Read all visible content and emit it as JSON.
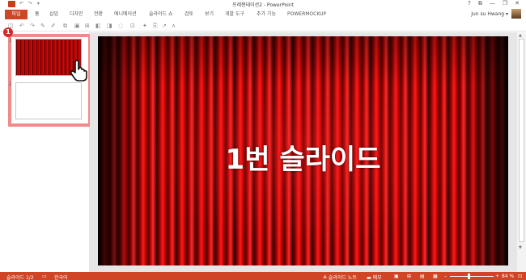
{
  "window": {
    "title": "프레젠테이션2 - PowerPoint",
    "qat_icons": "↶ ↷ ▾",
    "controls": [
      "?",
      "⧉",
      "—",
      "❐",
      "✕"
    ]
  },
  "ribbon": {
    "tabs": [
      "파일",
      "홈",
      "삽입",
      "디자인",
      "전환",
      "애니메이션",
      "슬라이드 쇼",
      "검토",
      "보기",
      "개발 도구",
      "추가 기능",
      "POWERMOCKUP"
    ],
    "user_name": "Jun su Hwang",
    "user_caret": "▾",
    "toolbar_icons": [
      "◫",
      "↶",
      "↷",
      "✎",
      "✐",
      "⧉",
      "▣",
      "⊞",
      "◧",
      "◨",
      "◌",
      "⊡",
      "✦",
      "⎘",
      "↗",
      "∧"
    ]
  },
  "thumbnails": {
    "badge": "1",
    "slides": [
      {
        "number": "1",
        "selected": true
      },
      {
        "number": "2",
        "selected": false
      }
    ]
  },
  "slide": {
    "title": "1번 슬라이드"
  },
  "scrollbar": {
    "up": "▲",
    "down": "▼"
  },
  "status": {
    "slide_counter": "슬라이드 1/2",
    "language": "한국어",
    "notes_label": "≜ 슬라이드 노트",
    "comments_label": "▬ 메모",
    "zoom_minus": "–",
    "zoom_plus": "+",
    "zoom_level": "84 %"
  },
  "colors": {
    "accent": "#d04525",
    "highlight": "#f08b8b"
  }
}
